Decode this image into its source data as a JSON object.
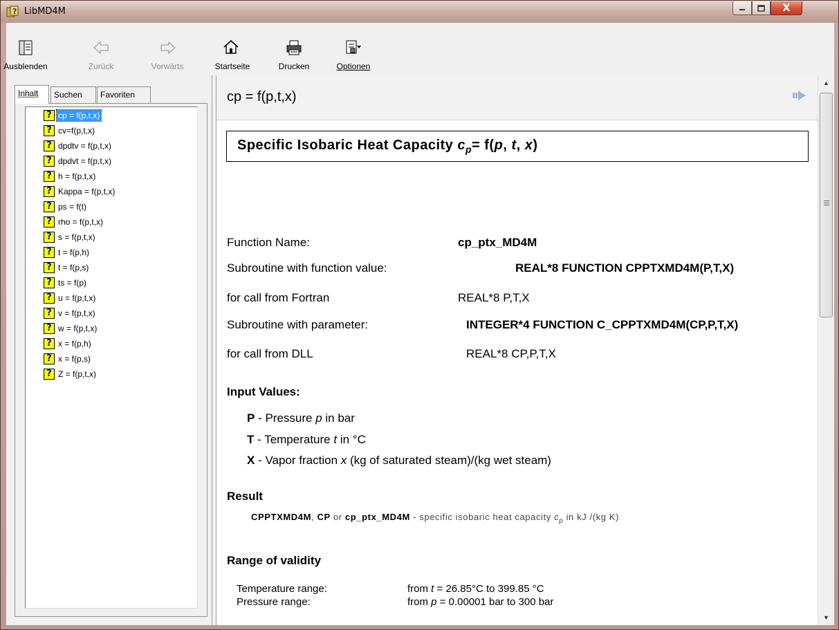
{
  "window": {
    "title": "LibMD4M",
    "icon": "help-book-icon",
    "controls": {
      "minimize": "minimize-icon",
      "maximize": "maximize-icon",
      "close": "X"
    }
  },
  "toolbar": {
    "buttons": [
      {
        "label": "Ausblenden",
        "icon": "hide-pane-icon",
        "enabled": true
      },
      {
        "label": "Zurück",
        "icon": "back-arrow-icon",
        "enabled": false
      },
      {
        "label": "Vorwärts",
        "icon": "forward-arrow-icon",
        "enabled": false
      },
      {
        "label": "Startseite",
        "icon": "home-icon",
        "enabled": true
      },
      {
        "label": "Drucken",
        "icon": "printer-icon",
        "enabled": true
      },
      {
        "label": "Optionen",
        "icon": "options-icon",
        "enabled": true
      }
    ]
  },
  "nav": {
    "tabs": [
      {
        "label": "Inhalt",
        "active": true
      },
      {
        "label": "Suchen",
        "active": false
      },
      {
        "label": "Favoriten",
        "active": false
      }
    ],
    "tree_icon": "?",
    "items": [
      {
        "label": "cp = f(p,t,x)",
        "selected": true
      },
      {
        "label": "cv=f(p,t,x)"
      },
      {
        "label": "dpdtv = f(p,t,x)"
      },
      {
        "label": "dpdvt = f(p,t,x)"
      },
      {
        "label": "h = f(p,t,x)"
      },
      {
        "label": "Kappa = f(p,t,x)"
      },
      {
        "label": "ps = f(t)"
      },
      {
        "label": "rho = f(p,t,x)"
      },
      {
        "label": "s = f(p,t,x)"
      },
      {
        "label": "t = f(p,h)"
      },
      {
        "label": "t = f(p,s)"
      },
      {
        "label": "ts = f(p)"
      },
      {
        "label": "u = f(p,t,x)"
      },
      {
        "label": "v = f(p,t,x)"
      },
      {
        "label": "w = f(p,t,x)"
      },
      {
        "label": "x = f(p,h)"
      },
      {
        "label": "x = f(p,s)"
      },
      {
        "label": "Z = f(p,t,x)"
      }
    ]
  },
  "content": {
    "topic_title": "cp = f(p,t,x)",
    "heading_text": "Specific Isobaric Heat Capacity ",
    "heading_formula": {
      "var": "c",
      "sub": "p",
      "eq": "= f(",
      "args": [
        "p",
        "t",
        "x"
      ],
      "close": ")"
    },
    "rows": [
      {
        "label": "Function Name:",
        "value": "cp_ptx_MD4M",
        "bold": true
      },
      {
        "label": "Subroutine with function value:",
        "value": "REAL*8 FUNCTION CPPTXMD4M(P,T,X)",
        "bold": true
      },
      {
        "label": "for call from Fortran",
        "value": "REAL*8 P,T,X",
        "bold": false
      },
      {
        "label": "Subroutine with parameter:",
        "value": "INTEGER*4 FUNCTION C_CPPTXMD4M(CP,P,T,X)",
        "bold": true
      },
      {
        "label": "for call from DLL",
        "value": "REAL*8 CP,P,T,X",
        "bold": false
      }
    ],
    "input_values_heading": "Input Values:",
    "inputs": [
      {
        "key": "P",
        "text": " - Pressure ",
        "var": "p",
        "rest": " in bar"
      },
      {
        "key": "T",
        "text": " - Temperature ",
        "var": "t",
        "rest": " in °C"
      },
      {
        "key": "X",
        "text": " - Vapor fraction ",
        "var": "x",
        "rest": " (kg of saturated steam)/(kg wet steam)"
      }
    ],
    "result_heading": "Result",
    "result": {
      "name1": "CPPTXMD4M",
      "sep1": ", ",
      "name2": "CP",
      "or": " or ",
      "name3": "cp_ptx_MD4M",
      "desc": " - specific isobaric heat capacity ",
      "var": "c",
      "sub": "p",
      "unit": " in kJ /(kg K)"
    },
    "range_heading": "Range of validity",
    "ranges": [
      {
        "label": "Temperature range:",
        "from": "from ",
        "var": "t",
        "value": " = 26.85°C  to  399.85 °C"
      },
      {
        "label": "Pressure range:",
        "from": "from ",
        "var": "p",
        "value": " = 0.00001 bar  to  300 bar"
      }
    ]
  }
}
